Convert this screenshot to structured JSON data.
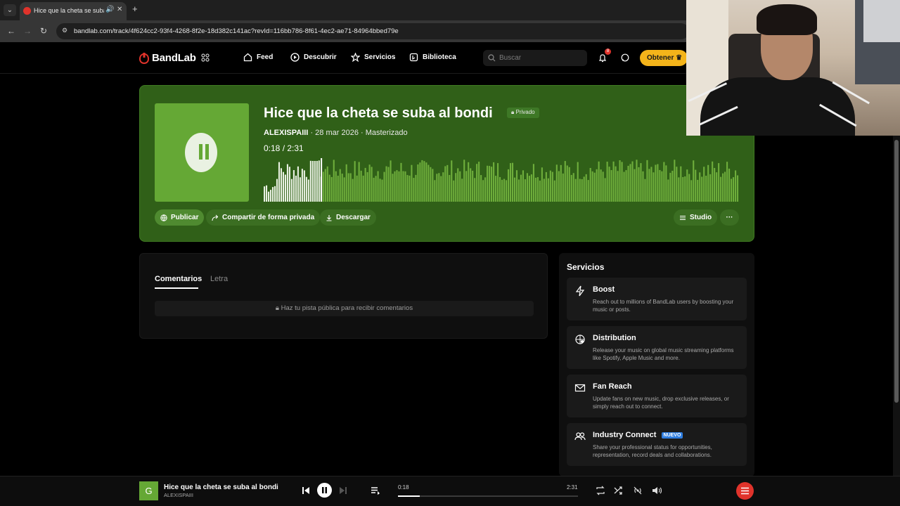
{
  "browser": {
    "tab_title": "Hice que la cheta se suba al bondi",
    "url": "bandlab.com/track/4f624cc2-93f4-4268-8f2e-18d382c141ac?revId=116bb786-8f61-4ec2-ae71-84964bbed79e"
  },
  "header": {
    "logo": "BandLab",
    "nav": [
      "Feed",
      "Descubrir",
      "Servicios",
      "Biblioteca"
    ],
    "search_placeholder": "Buscar",
    "notification_count": "8",
    "get_label": "Obtener"
  },
  "track": {
    "title": "Hice que la cheta se suba al bondi",
    "privacy": "Privado",
    "artist": "ALEXISPAIII",
    "date": "28 mar 2026",
    "status": "Masterizado",
    "time": "0:18 /  2:31",
    "progress": 0.12
  },
  "actions": {
    "publish": "Publicar",
    "share_private": "Compartir de forma privada",
    "download": "Descargar",
    "studio": "Studio"
  },
  "comments": {
    "tab_comments": "Comentarios",
    "tab_lyrics": "Letra",
    "notice": "Haz tu pista pública para recibir comentarios"
  },
  "services": {
    "title": "Servicios",
    "items": [
      {
        "name": "Boost",
        "desc": "Reach out to millions of BandLab users by boosting your music or posts.",
        "icon": "lightning-icon"
      },
      {
        "name": "Distribution",
        "desc": "Release your music on global music streaming platforms like Spotify, Apple Music and more.",
        "icon": "globe-music-icon"
      },
      {
        "name": "Fan Reach",
        "desc": "Update fans on new music, drop exclusive releases, or simply reach out to connect.",
        "icon": "mail-icon"
      },
      {
        "name": "Industry Connect",
        "badge": "NUEVO",
        "desc": "Share your professional status for opportunities, representation, record deals and collaborations.",
        "icon": "people-icon"
      }
    ]
  },
  "player": {
    "title": "Hice que la cheta se suba al bondi",
    "artist": "ALEXISPAIII",
    "thumb_letter": "G",
    "current": "0:18",
    "total": "2:31",
    "progress": 0.12
  },
  "colors": {
    "hero_bg": "#306018",
    "accent_green": "#65a835",
    "brand_red": "#e0332b",
    "get_yellow": "#f4b41a"
  }
}
